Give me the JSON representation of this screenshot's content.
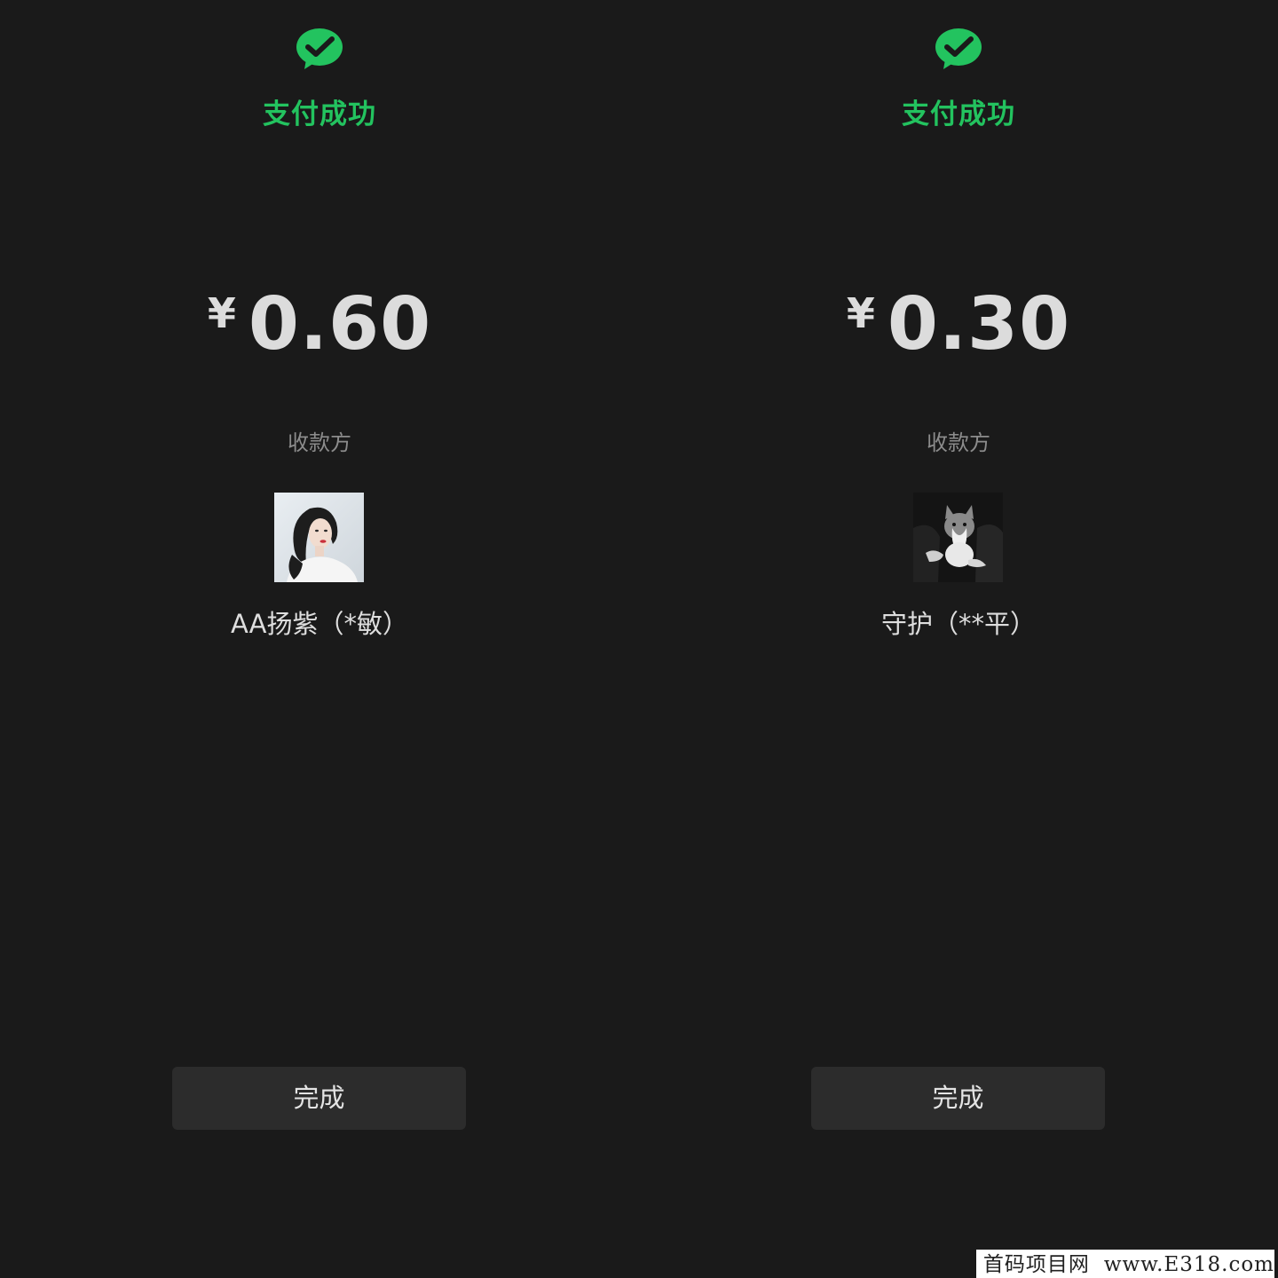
{
  "screens": [
    {
      "status_title": "支付成功",
      "currency_symbol": "¥",
      "amount": "0.60",
      "payee_label": "收款方",
      "payee_name": "AA扬紫（*敏）",
      "done_label": "完成"
    },
    {
      "status_title": "支付成功",
      "currency_symbol": "¥",
      "amount": "0.30",
      "payee_label": "收款方",
      "payee_name": "守护（**平）",
      "done_label": "完成"
    }
  ],
  "watermark": {
    "name": "首码项目网",
    "site": "www.E318.com"
  },
  "colors": {
    "background": "#1a1a1a",
    "success_green": "#23c35f",
    "button_bg": "#2c2c2c"
  },
  "icons": {
    "success": "wechat-pay-check-icon"
  }
}
